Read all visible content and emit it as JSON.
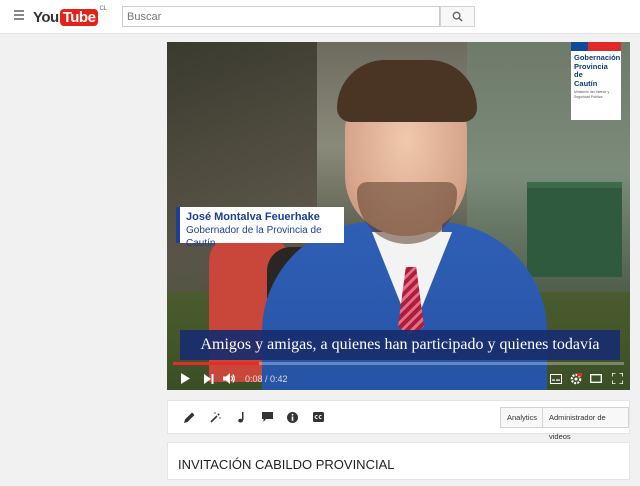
{
  "header": {
    "logo_you": "You",
    "logo_tube": "Tube",
    "logo_country": "CL",
    "search_placeholder": "Buscar"
  },
  "video": {
    "gov_logo_line1": "Gobernación",
    "gov_logo_line2": "Provincia de",
    "gov_logo_line3": "Cautín",
    "gov_logo_sub": "Ministerio del Interior y Seguridad Pública",
    "name": "José Montalva Feuerhake",
    "role": "Gobernador de la Provincia de Cautín",
    "subtitle": "Amigos y amigas, a quienes han participado y quienes todavía",
    "time_current": "0:08",
    "time_total": "0:42",
    "time_separator": " / ",
    "progress": 0.19
  },
  "actions": {
    "analytics_label": "Analytics",
    "admin_label": "Administrador de videos",
    "icons": [
      "pencil-icon",
      "magic-wand-icon",
      "music-note-icon",
      "comment-icon",
      "info-icon",
      "cc-icon"
    ]
  },
  "title": {
    "text": "INVITACIÓN CABILDO PROVINCIAL"
  },
  "colors": {
    "brand_red": "#e62117",
    "progress_red": "#e52d27",
    "navy": "#1d3f8f"
  }
}
